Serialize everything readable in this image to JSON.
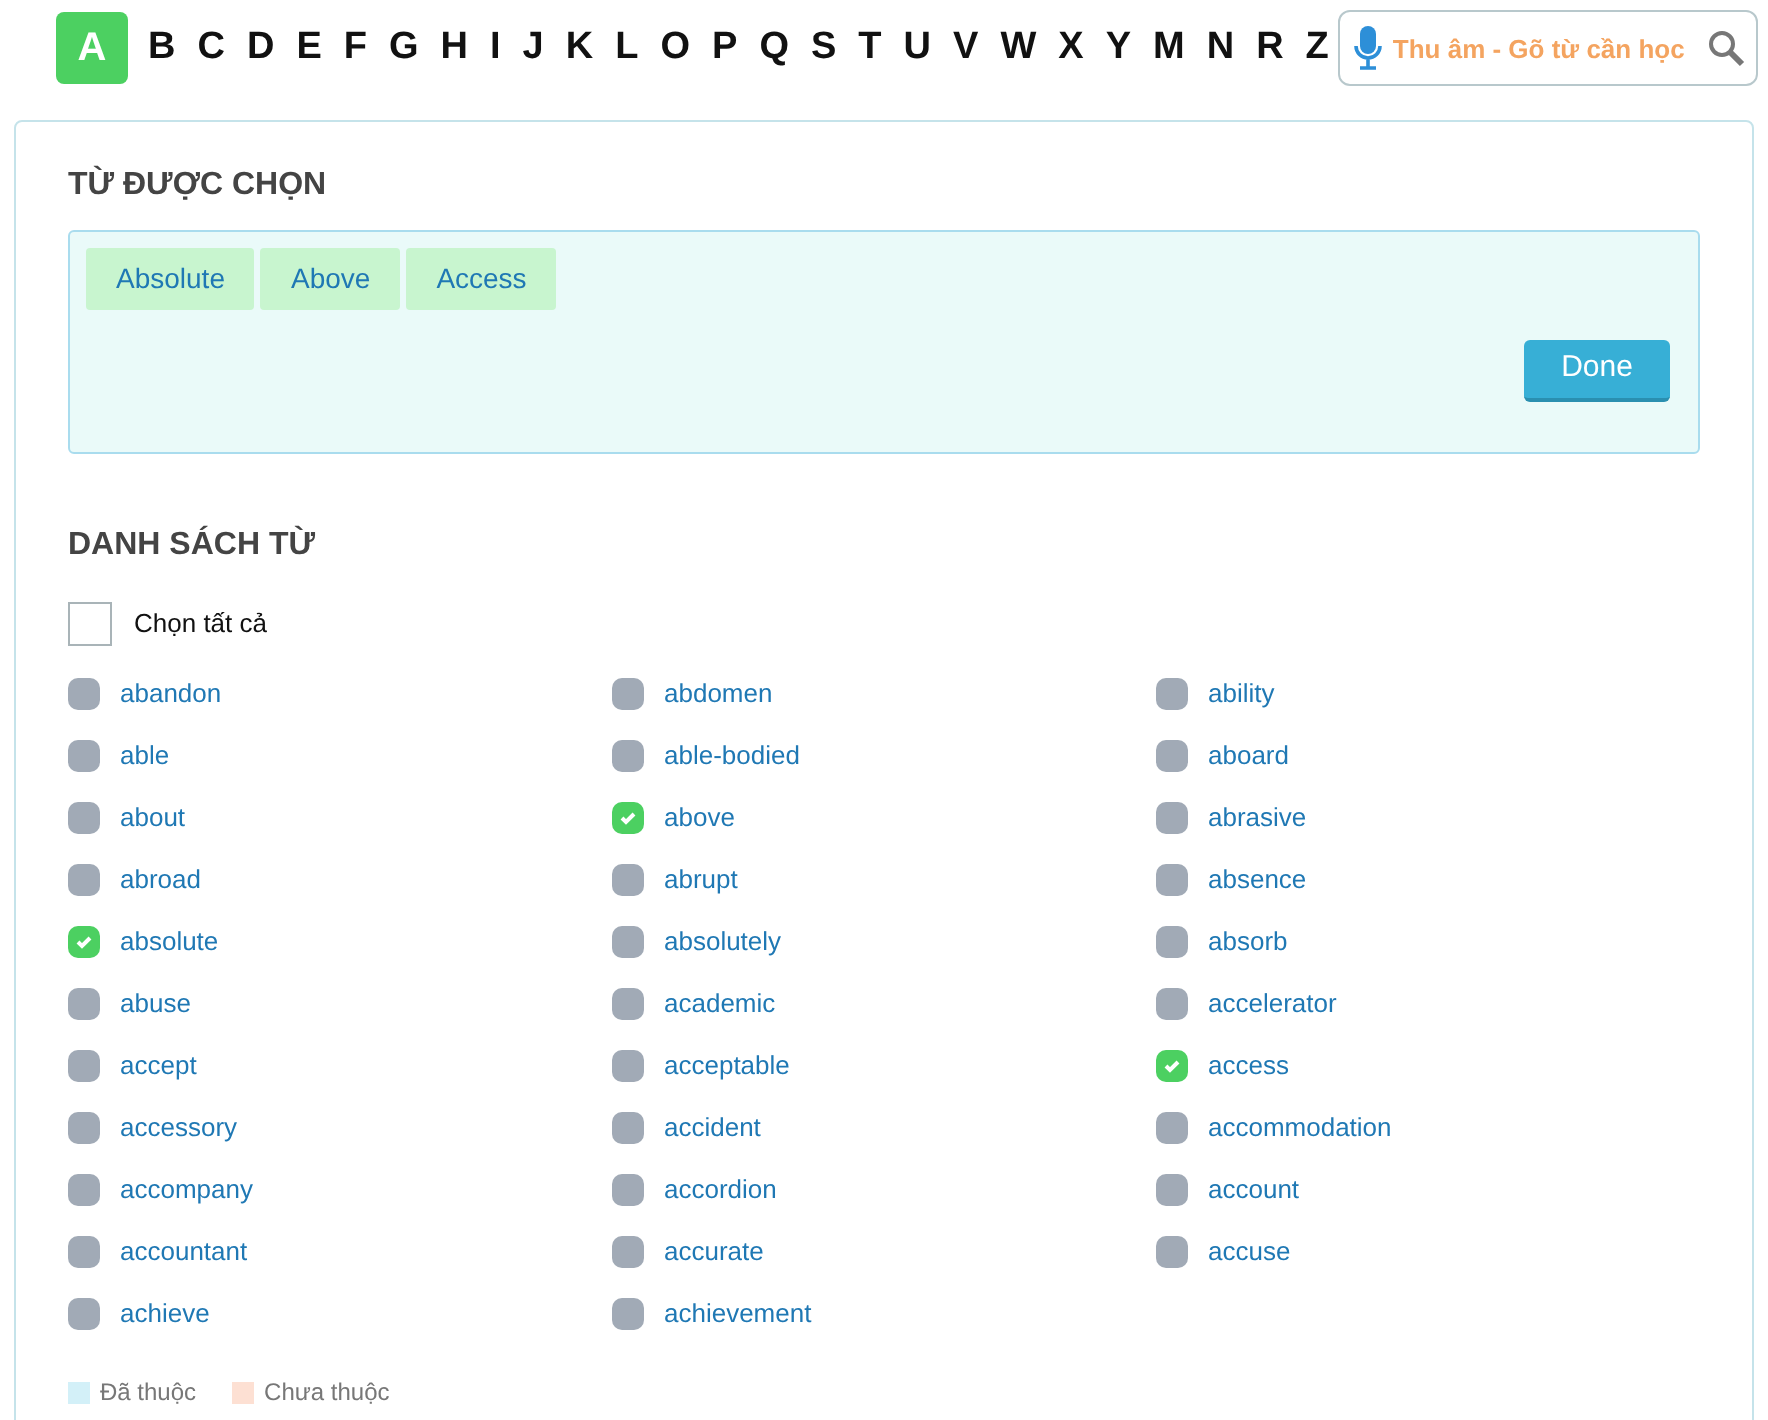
{
  "letters": [
    {
      "label": "A",
      "selected": true
    },
    {
      "label": "B",
      "selected": false
    },
    {
      "label": "C",
      "selected": false
    },
    {
      "label": "D",
      "selected": false
    },
    {
      "label": "E",
      "selected": false
    },
    {
      "label": "F",
      "selected": false
    },
    {
      "label": "G",
      "selected": false
    },
    {
      "label": "H",
      "selected": false
    },
    {
      "label": "I",
      "selected": false
    },
    {
      "label": "J",
      "selected": false
    },
    {
      "label": "K",
      "selected": false
    },
    {
      "label": "L",
      "selected": false
    },
    {
      "label": "O",
      "selected": false
    },
    {
      "label": "P",
      "selected": false
    },
    {
      "label": "Q",
      "selected": false
    },
    {
      "label": "S",
      "selected": false
    },
    {
      "label": "T",
      "selected": false
    },
    {
      "label": "U",
      "selected": false
    },
    {
      "label": "V",
      "selected": false
    },
    {
      "label": "W",
      "selected": false
    },
    {
      "label": "X",
      "selected": false
    },
    {
      "label": "Y",
      "selected": false
    },
    {
      "label": "M",
      "selected": false
    },
    {
      "label": "N",
      "selected": false
    },
    {
      "label": "R",
      "selected": false
    },
    {
      "label": "Z",
      "selected": false
    }
  ],
  "search": {
    "placeholder": "Thu âm - Gõ từ cần học"
  },
  "selected_section": {
    "title": "TỪ ĐƯỢC CHỌN",
    "chips": [
      "Absolute",
      "Above",
      "Access"
    ],
    "button": "Done"
  },
  "list_section": {
    "title": "DANH SÁCH TỪ",
    "select_all": {
      "label": "Chọn tất cả",
      "checked": false
    },
    "words": [
      {
        "label": "abandon",
        "checked": false
      },
      {
        "label": "abdomen",
        "checked": false
      },
      {
        "label": "ability",
        "checked": false
      },
      {
        "label": "able",
        "checked": false
      },
      {
        "label": "able-bodied",
        "checked": false
      },
      {
        "label": "aboard",
        "checked": false
      },
      {
        "label": "about",
        "checked": false
      },
      {
        "label": "above",
        "checked": true
      },
      {
        "label": "abrasive",
        "checked": false
      },
      {
        "label": "abroad",
        "checked": false
      },
      {
        "label": "abrupt",
        "checked": false
      },
      {
        "label": "absence",
        "checked": false
      },
      {
        "label": "absolute",
        "checked": true
      },
      {
        "label": "absolutely",
        "checked": false
      },
      {
        "label": "absorb",
        "checked": false
      },
      {
        "label": "abuse",
        "checked": false
      },
      {
        "label": "academic",
        "checked": false
      },
      {
        "label": "accelerator",
        "checked": false
      },
      {
        "label": "accept",
        "checked": false
      },
      {
        "label": "acceptable",
        "checked": false
      },
      {
        "label": "access",
        "checked": true
      },
      {
        "label": "accessory",
        "checked": false
      },
      {
        "label": "accident",
        "checked": false
      },
      {
        "label": "accommodation",
        "checked": false
      },
      {
        "label": "accompany",
        "checked": false
      },
      {
        "label": "accordion",
        "checked": false
      },
      {
        "label": "account",
        "checked": false
      },
      {
        "label": "accountant",
        "checked": false
      },
      {
        "label": "accurate",
        "checked": false
      },
      {
        "label": "accuse",
        "checked": false
      },
      {
        "label": "achieve",
        "checked": false
      },
      {
        "label": "achievement",
        "checked": false
      }
    ],
    "legend": [
      {
        "label": "Đã thuộc",
        "color": "#d3f0f8"
      },
      {
        "label": "Chưa thuộc",
        "color": "#fde0d3"
      }
    ]
  }
}
